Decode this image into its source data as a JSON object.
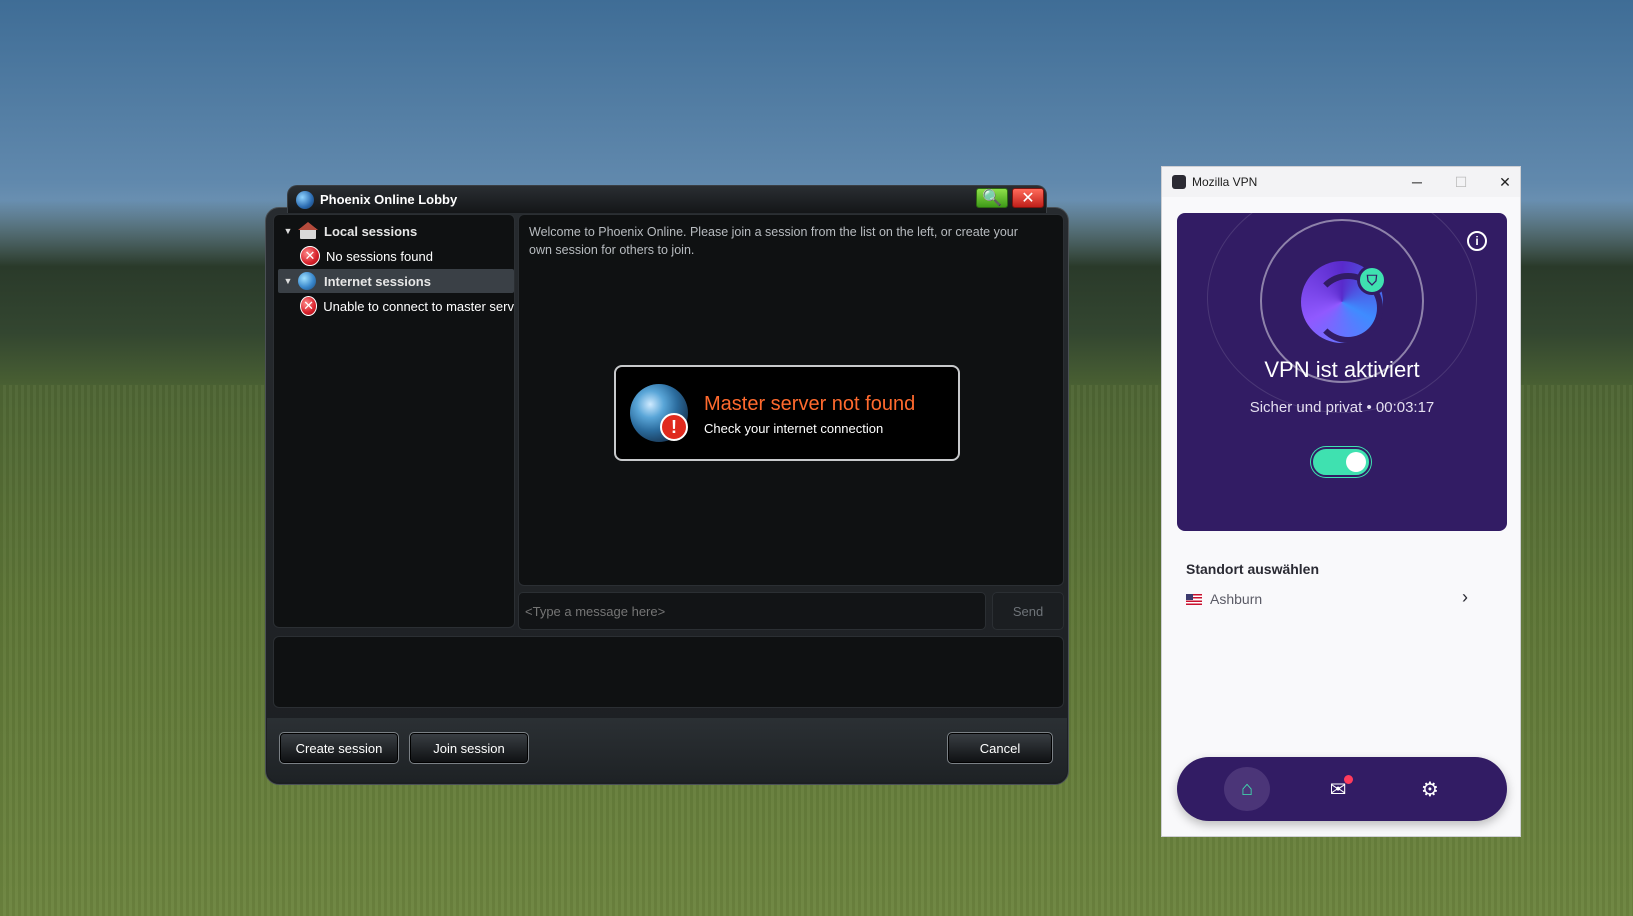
{
  "phoenix": {
    "title": "Phoenix Online Lobby",
    "tree": {
      "local_group": "Local sessions",
      "local_item": "No sessions found",
      "internet_group": "Internet sessions",
      "internet_item": "Unable to connect to master serv"
    },
    "welcome": "Welcome to Phoenix Online. Please join a session from the list on the left, or create your own session for others to join.",
    "error": {
      "title": "Master server not found",
      "subtitle": "Check your internet connection"
    },
    "chat_input_placeholder": "<Type a message here>",
    "send_label": "Send",
    "buttons": {
      "create": "Create session",
      "join": "Join session",
      "cancel": "Cancel"
    }
  },
  "vpn": {
    "window_title": "Mozilla VPN",
    "status": "VPN ist aktiviert",
    "substatus_text": "Sicher und privat",
    "substatus_sep": "•",
    "timer": "00:03:17",
    "toggle_on": true,
    "location_heading": "Standort auswählen",
    "location_name": "Ashburn",
    "colors": {
      "brand_purple": "#321c64",
      "accent_green": "#3fe1b0"
    }
  }
}
